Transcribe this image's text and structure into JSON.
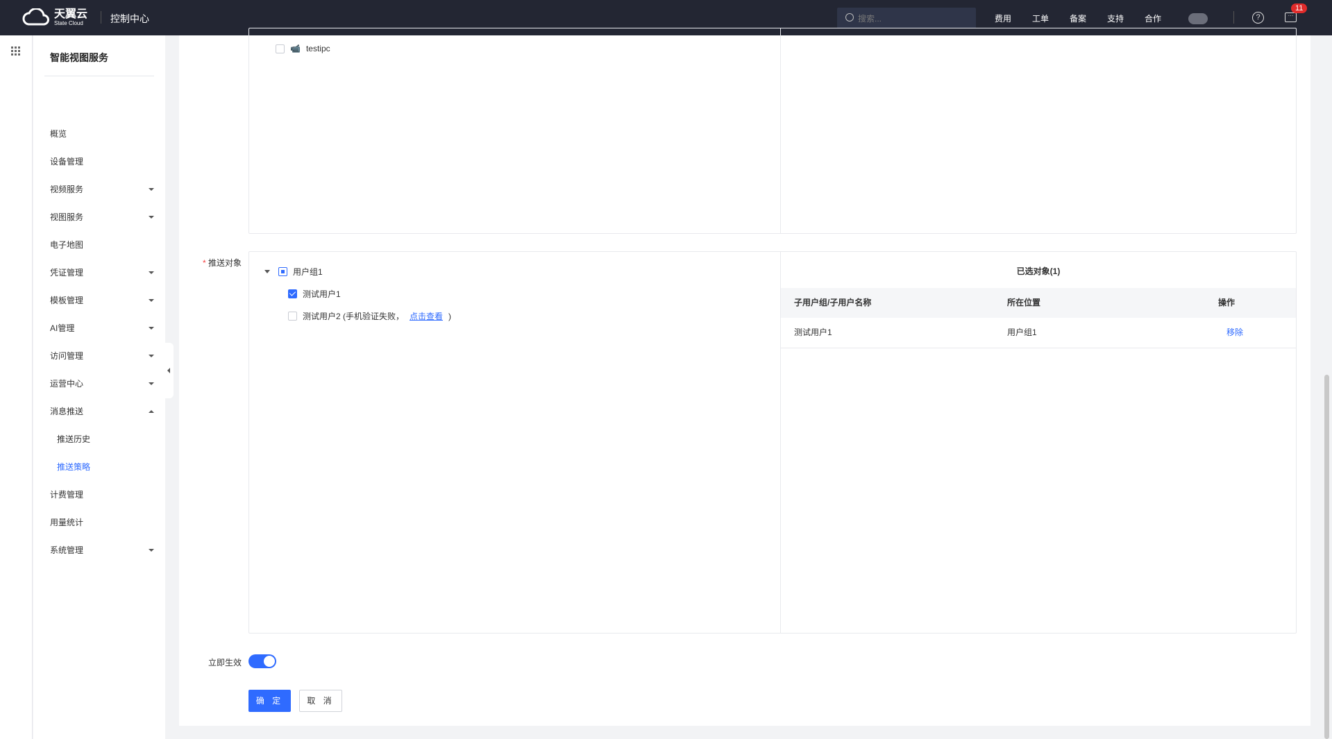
{
  "header": {
    "logo_cn": "天翼云",
    "logo_en": "State Cloud",
    "console": "控制中心",
    "search_placeholder": "搜索...",
    "nav": [
      "费用",
      "工单",
      "备案",
      "支持",
      "合作"
    ],
    "help": "?",
    "badge": "11"
  },
  "sidebar": {
    "title": "智能视图服务",
    "items": [
      {
        "label": "概览",
        "caret": ""
      },
      {
        "label": "设备管理",
        "caret": ""
      },
      {
        "label": "视频服务",
        "caret": "down"
      },
      {
        "label": "视图服务",
        "caret": "down"
      },
      {
        "label": "电子地图",
        "caret": ""
      },
      {
        "label": "凭证管理",
        "caret": "down"
      },
      {
        "label": "模板管理",
        "caret": "down"
      },
      {
        "label": "AI管理",
        "caret": "down"
      },
      {
        "label": "访问管理",
        "caret": "down"
      },
      {
        "label": "运营中心",
        "caret": "down"
      },
      {
        "label": "消息推送",
        "caret": "up"
      },
      {
        "label": "推送历史",
        "caret": "",
        "sub": true
      },
      {
        "label": "推送策略",
        "caret": "",
        "sub": true,
        "active": true
      },
      {
        "label": "计费管理",
        "caret": ""
      },
      {
        "label": "用量统计",
        "caret": ""
      },
      {
        "label": "系统管理",
        "caret": "down"
      }
    ]
  },
  "device_tree": {
    "item": "testipc"
  },
  "push_target": {
    "label": "推送对象",
    "group": "用户组1",
    "user1": "测试用户1",
    "user2": "测试用户2 (手机验证失败，",
    "user2_link": "点击查看",
    "user2_close": ")",
    "selected_title": "已选对象(1)",
    "columns": [
      "子用户组/子用户名称",
      "所在位置",
      "操作"
    ],
    "rows": [
      {
        "name": "测试用户1",
        "location": "用户组1",
        "action": "移除"
      }
    ]
  },
  "effective": {
    "label": "立即生效",
    "on": true
  },
  "buttons": {
    "confirm": "确 定",
    "cancel": "取 消"
  }
}
